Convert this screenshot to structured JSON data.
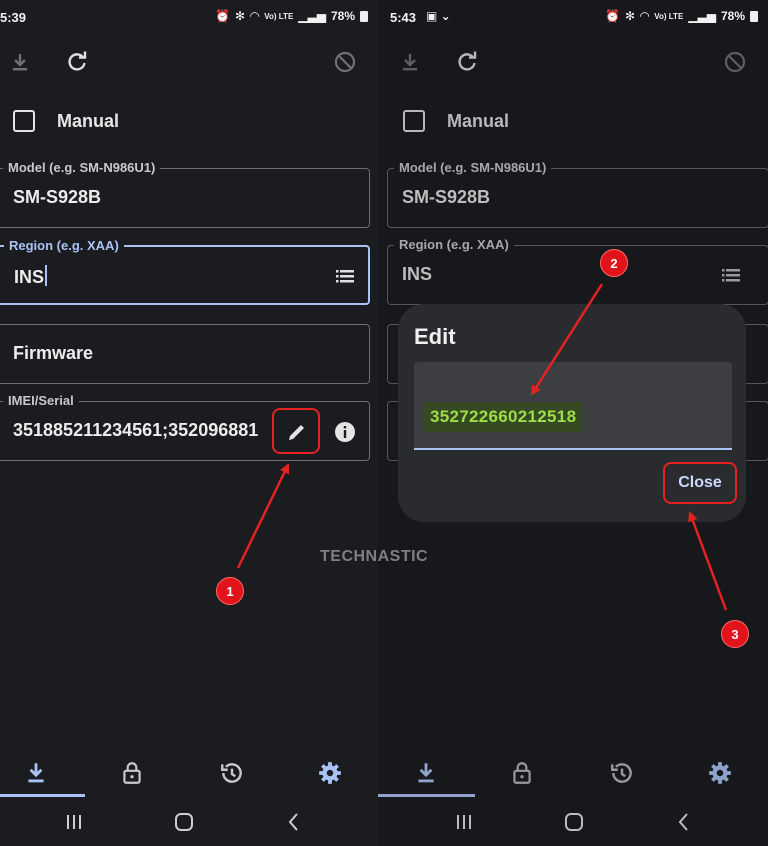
{
  "colors": {
    "accent": "#a9c3f6",
    "annotation_red": "#e52222",
    "highlight_text": "#9fdd47"
  },
  "left": {
    "status_time": "5:39",
    "battery": "78%",
    "toolbar": {
      "download_icon": "download-icon",
      "refresh_icon": "refresh-icon",
      "block_icon": "block-icon"
    },
    "manual_label": "Manual",
    "model": {
      "label": "Model (e.g. SM-N986U1)",
      "value": "SM-S928B"
    },
    "region": {
      "label": "Region (e.g. XAA)",
      "value": "INS"
    },
    "firmware": {
      "value": "Firmware"
    },
    "imei": {
      "label": "IMEI/Serial",
      "value": "351885211234561;352096881"
    },
    "callout": "1"
  },
  "right": {
    "status_time": "5:43",
    "battery": "78%",
    "manual_label": "Manual",
    "model": {
      "label": "Model (e.g. SM-N986U1)",
      "value": "SM-S928B"
    },
    "region": {
      "label": "Region (e.g. XAA)",
      "value": "INS"
    },
    "dialog": {
      "title": "Edit",
      "value": "352722660212518",
      "close_label": "Close"
    },
    "callout_field": "2",
    "callout_close": "3"
  },
  "watermark": "TECHNASTIC",
  "status_net": "Vo) LTE"
}
